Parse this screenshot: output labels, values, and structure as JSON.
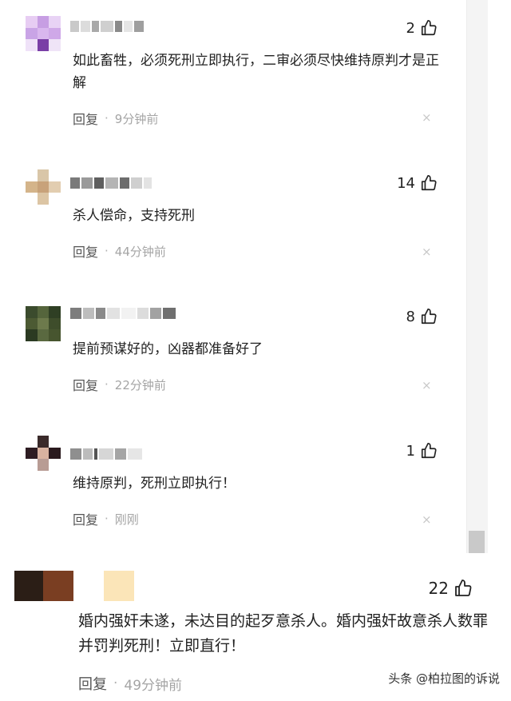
{
  "comments": [
    {
      "text": "如此畜牲，必须死刑立即执行，二审必须尽快维持原判才是正解",
      "likes": "2",
      "reply": "回复",
      "dot": "·",
      "time": "9分钟前",
      "close": "×",
      "avatar_colors": [
        "#e7cdf3",
        "#c79ee3",
        "#e8d3f5",
        "#c9a4e6",
        "#d9b7ee",
        "#cfa8e8",
        "#efe2f8",
        "#7a3fa6",
        "#efe4f7"
      ]
    },
    {
      "text": "杀人偿命，支持死刑",
      "likes": "14",
      "reply": "回复",
      "dot": "·",
      "time": "44分钟前",
      "close": "×",
      "avatar_colors": [
        "#ffffff",
        "#d9c6a8",
        "#ffffff",
        "#d4b48a",
        "#c8a27a",
        "#e2cdb0",
        "#ffffff",
        "#dcc5a4",
        "#ffffff"
      ]
    },
    {
      "text": "提前预谋好的，凶器都准备好了",
      "likes": "8",
      "reply": "回复",
      "dot": "·",
      "time": "22分钟前",
      "close": "×",
      "avatar_colors": [
        "#3b4b2d",
        "#55653c",
        "#2f3f24",
        "#4c5a33",
        "#6d7a4c",
        "#3e4d2b",
        "#2b3a22",
        "#5a6940",
        "#47552f"
      ]
    },
    {
      "text": "维持原判，死刑立即执行！",
      "likes": "1",
      "reply": "回复",
      "dot": "·",
      "time": "刚刚",
      "close": "×",
      "avatar_colors": [
        "#ffffff",
        "#3a2a2a",
        "#ffffff",
        "#2d1c22",
        "#d8b2a0",
        "#2a1a1e",
        "#ffffff",
        "#b89c94",
        "#ffffff"
      ]
    }
  ],
  "bottom_comment": {
    "text": "婚内强奸未遂，未达目的起歹意杀人。婚内强奸故意杀人数罪并罚判死刑！立即直行！",
    "likes": "22",
    "reply": "回复",
    "dot": "·",
    "time": "49分钟前",
    "avatar_colors": [
      "#2b1e16",
      "#7a3e22",
      "#ffffff",
      "#fbe5b8"
    ]
  },
  "watermark": "头条 @柏拉图的诉说",
  "colors": {
    "thumb": "#222222",
    "meta": "#a5a5a5"
  }
}
